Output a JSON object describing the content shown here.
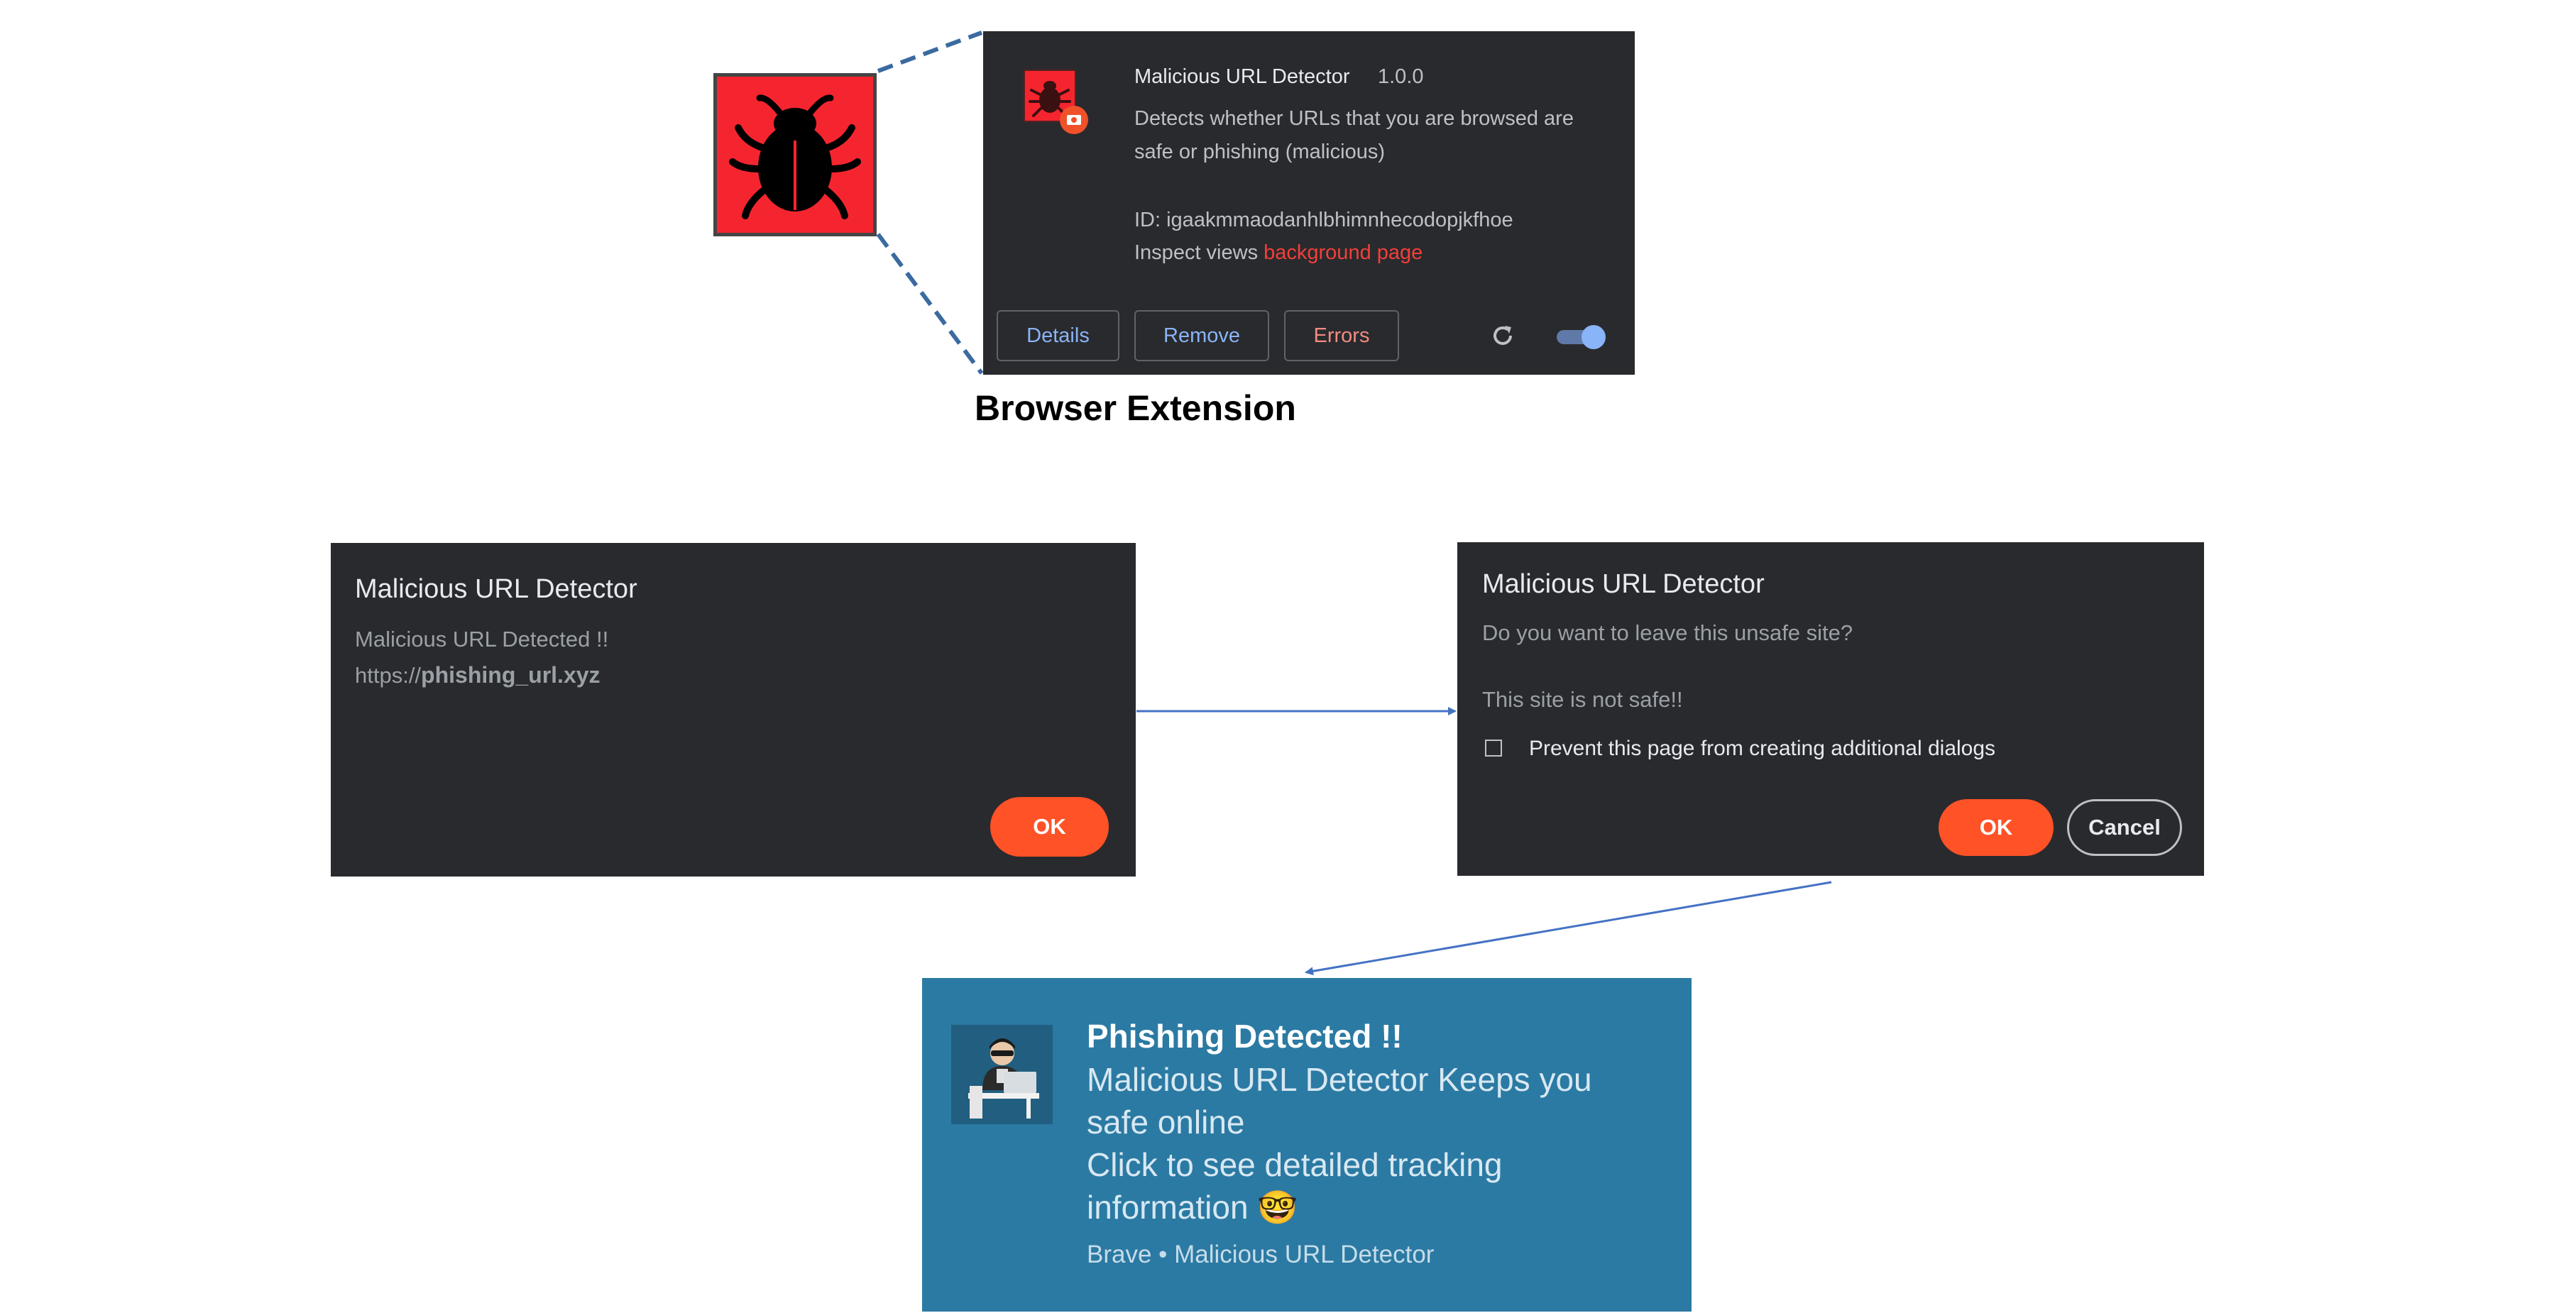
{
  "extension": {
    "caption": "Browser Extension",
    "name": "Malicious URL Detector",
    "version": "1.0.0",
    "description": "Detects whether URLs that you are browsed are safe or phishing (malicious)",
    "id_line": "ID: igaakmmaodanhlbhimnhecodopjkfhoe",
    "inspect_prefix": "Inspect views ",
    "inspect_link": "background page",
    "buttons": {
      "details": "Details",
      "remove": "Remove",
      "errors": "Errors"
    },
    "toggle_on": true,
    "colors": {
      "accent": "#8ab4f8",
      "error": "#f28b82",
      "link": "#f33f3a",
      "icon_red": "#f5252f"
    }
  },
  "alert_dialog": {
    "title": "Malicious URL Detector",
    "line1": "Malicious URL Detected !!",
    "url_prefix": "https://",
    "url_bold": "phishing_url.xyz",
    "ok_label": "OK"
  },
  "confirm_dialog": {
    "title": "Malicious URL Detector",
    "question": "Do you want to leave this unsafe site?",
    "message": "This site is not safe!!",
    "checkbox_label": "Prevent this page from creating additional dialogs",
    "ok_label": "OK",
    "cancel_label": "Cancel",
    "colors": {
      "ok": "#ff5227"
    }
  },
  "notification": {
    "title": "Phishing Detected !!",
    "body_line1": "Malicious URL Detector Keeps you safe online",
    "body_line2": "Click to see detailed tracking information",
    "emoji": "🤓",
    "footer": "Brave • Malicious URL Detector",
    "colors": {
      "background": "#2b7aa3"
    }
  }
}
